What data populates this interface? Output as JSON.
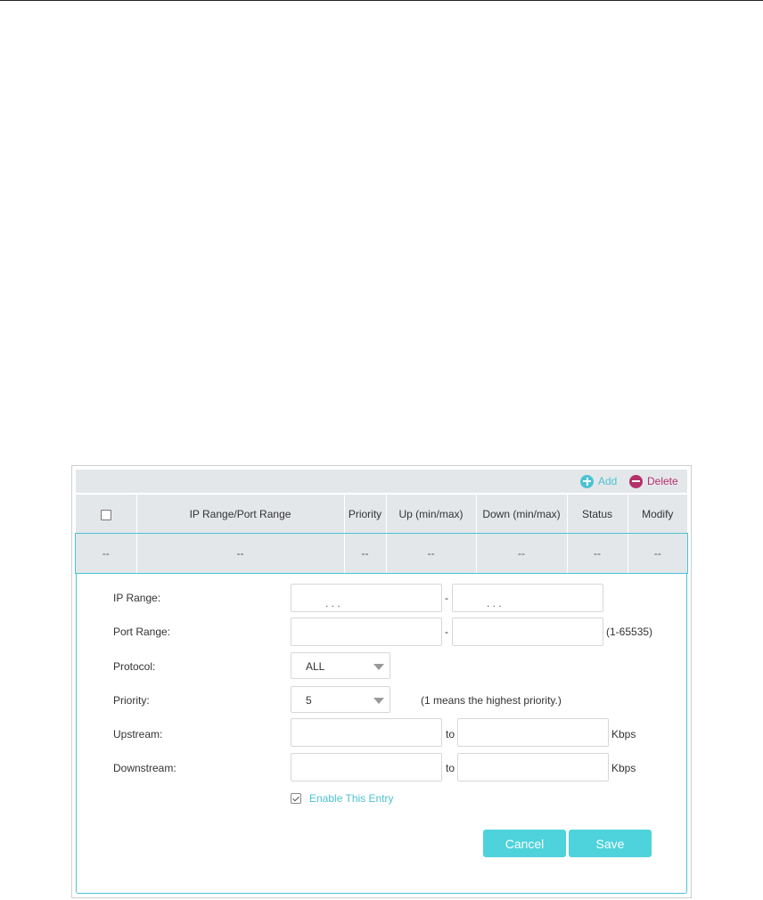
{
  "toolbar": {
    "add_label": "Add",
    "delete_label": "Delete",
    "add_icon": "plus-circle-icon",
    "delete_icon": "minus-circle-icon"
  },
  "table": {
    "columns": [
      "",
      "IP Range/Port Range",
      "Priority",
      "Up (min/max)",
      "Down (min/max)",
      "Status",
      "Modify"
    ],
    "rows": [
      [
        "--",
        "--",
        "--",
        "--",
        "--",
        "--",
        "--"
      ]
    ]
  },
  "form": {
    "ip_range_label": "IP Range:",
    "ip_dots": ".        .        .",
    "port_range_label": "Port Range:",
    "port_range_hint": "(1-65535)",
    "protocol_label": "Protocol:",
    "protocol_value": "ALL",
    "priority_label": "Priority:",
    "priority_value": "5",
    "priority_hint": "(1 means the highest priority.)",
    "upstream_label": "Upstream:",
    "downstream_label": "Downstream:",
    "to_label": "to",
    "unit_label": "Kbps",
    "range_dash": "-",
    "enable_label": "Enable This Entry",
    "enable_checked": true
  },
  "buttons": {
    "cancel": "Cancel",
    "save": "Save"
  },
  "colors": {
    "accent": "#4bc3d2",
    "delete": "#b5306b",
    "header_bg": "#e4e7ea",
    "button_bg": "#4ed2db"
  }
}
